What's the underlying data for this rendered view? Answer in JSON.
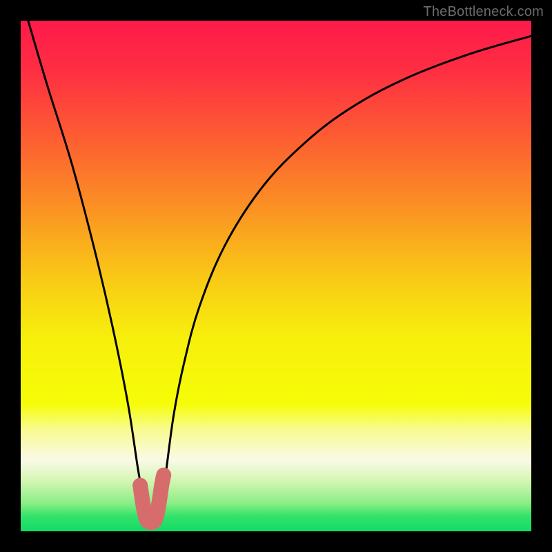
{
  "watermark": "TheBottleneck.com",
  "colors": {
    "background": "#000000",
    "gradient_stops": [
      {
        "offset": 0.0,
        "color": "#fe1a4a"
      },
      {
        "offset": 0.1,
        "color": "#fe2f42"
      },
      {
        "offset": 0.22,
        "color": "#fd5a33"
      },
      {
        "offset": 0.35,
        "color": "#fb8b25"
      },
      {
        "offset": 0.5,
        "color": "#f9c816"
      },
      {
        "offset": 0.62,
        "color": "#f7ef0c"
      },
      {
        "offset": 0.75,
        "color": "#f6fd07"
      },
      {
        "offset": 0.8,
        "color": "#f8fb8e"
      },
      {
        "offset": 0.86,
        "color": "#faf9e8"
      },
      {
        "offset": 0.9,
        "color": "#d6f6b4"
      },
      {
        "offset": 0.945,
        "color": "#8aee85"
      },
      {
        "offset": 0.97,
        "color": "#34e36a"
      },
      {
        "offset": 1.0,
        "color": "#12db66"
      }
    ],
    "curve": "#000000",
    "thumb": "#d66d6c"
  },
  "chart_data": {
    "type": "line",
    "title": "",
    "xlabel": "",
    "ylabel": "",
    "xlim": [
      0,
      100
    ],
    "ylim": [
      0,
      100
    ],
    "series": [
      {
        "name": "bottleneck-curve",
        "x": [
          0.0,
          5.0,
          10.0,
          14.5,
          18.0,
          21.0,
          23.0,
          24.2,
          25.0,
          26.5,
          27.5,
          28.5,
          30.0,
          32.0,
          35.0,
          40.0,
          47.0,
          55.0,
          64.0,
          75.0,
          88.0,
          100.0
        ],
        "values": [
          105.0,
          88.0,
          72.0,
          55.0,
          40.0,
          25.0,
          12.0,
          5.5,
          1.8,
          1.8,
          5.0,
          12.0,
          23.0,
          33.0,
          44.0,
          56.0,
          67.0,
          75.5,
          82.5,
          88.5,
          93.5,
          97.0
        ]
      }
    ],
    "thumb_segment": {
      "x": [
        23.4,
        24.0,
        24.6,
        25.2,
        25.8,
        26.4,
        27.0,
        27.6,
        28.0
      ],
      "values": [
        9.0,
        5.0,
        2.4,
        1.8,
        1.8,
        2.4,
        5.0,
        9.0,
        11.0
      ]
    }
  }
}
